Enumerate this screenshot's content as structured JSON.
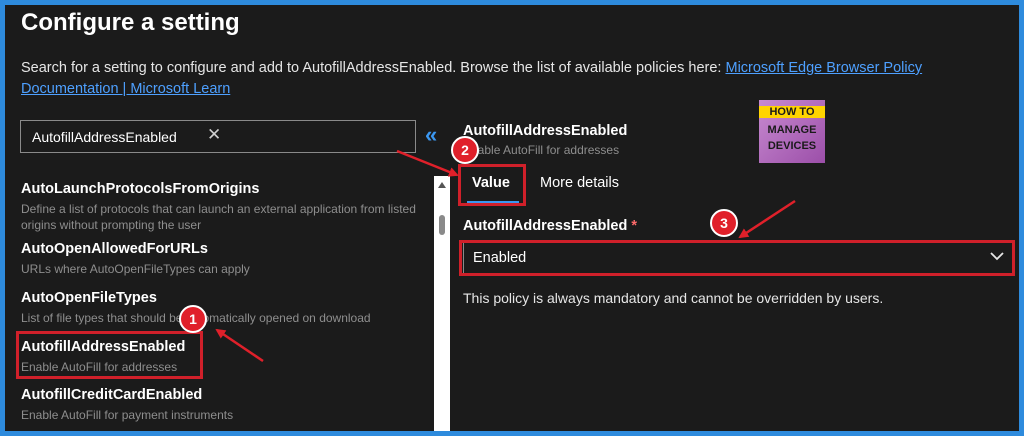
{
  "header": {
    "title": "Configure a setting",
    "description": "Search for a setting to configure and add to AutofillAddressEnabled. Browse the list of available policies here: ",
    "link_text": "Microsoft Edge Browser Policy Documentation | Microsoft Learn"
  },
  "search": {
    "value": "AutofillAddressEnabled",
    "clear_icon": "✕"
  },
  "collapse_icon": "«",
  "settings_list": [
    {
      "name": "AutoLaunchProtocolsFromOrigins",
      "description": "Define a list of protocols that can launch an external application from listed origins without prompting the user"
    },
    {
      "name": "AutoOpenAllowedForURLs",
      "description": "URLs where AutoOpenFileTypes can apply"
    },
    {
      "name": "AutoOpenFileTypes",
      "description": "List of file types that should be automatically opened on download"
    },
    {
      "name": "AutofillAddressEnabled",
      "description": "Enable AutoFill for addresses"
    },
    {
      "name": "AutofillCreditCardEnabled",
      "description": "Enable AutoFill for payment instruments"
    }
  ],
  "detail": {
    "name": "AutofillAddressEnabled",
    "description": "Enable AutoFill for addresses",
    "tabs": [
      "Value",
      "More details"
    ],
    "field_label": "AutofillAddressEnabled",
    "required_mark": "*",
    "selected_value": "Enabled",
    "note": "This policy is always mandatory and cannot be overridden by users."
  },
  "logo": {
    "line1": "HOW TO",
    "line2": "MANAGE",
    "line3": "DEVICES"
  },
  "callouts": [
    "1",
    "2",
    "3"
  ],
  "colors": {
    "accent": "#2e8bdd",
    "highlight": "#d0202a",
    "link": "#4ea0ff",
    "background": "#1b1b1b"
  }
}
